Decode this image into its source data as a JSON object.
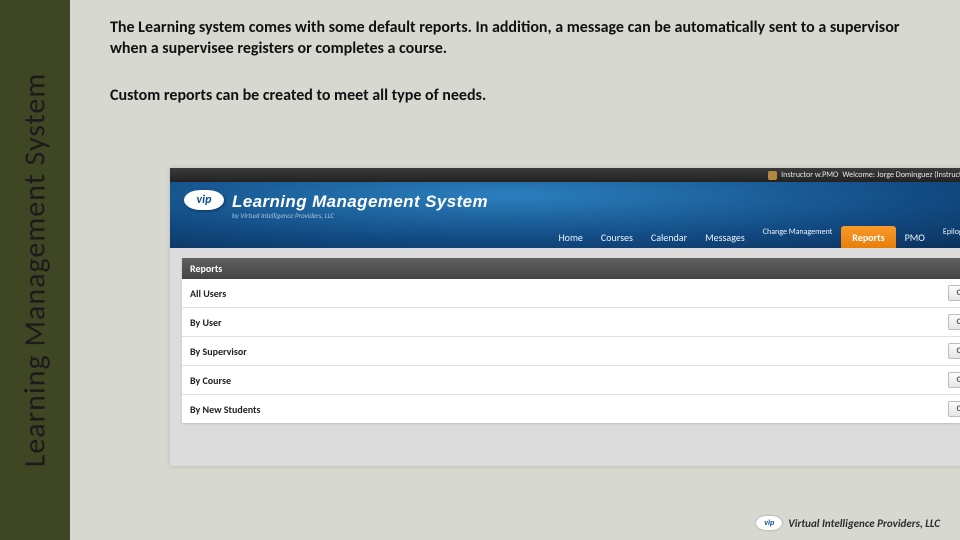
{
  "sidebar": {
    "title": "Learning Management System"
  },
  "body": {
    "para1": "The Learning system comes with some default reports. In addition, a message can be automatically sent to a supervisor when a supervisee registers or completes a course.",
    "para2": "Custom reports can be created to meet all type of needs."
  },
  "app": {
    "topbar": {
      "role": "Instructor w.PMO",
      "welcome": "Welcome: Jorge Dominguez (Instructor Portal)"
    },
    "brand": {
      "logo_text": "vip",
      "title": "Learning Management System",
      "subtitle": "by Virtual Intelligence Providers, LLC"
    },
    "nav": [
      {
        "label": "Home",
        "active": false
      },
      {
        "label": "Courses",
        "active": false
      },
      {
        "label": "Calendar",
        "active": false
      },
      {
        "label": "Messages",
        "active": false
      },
      {
        "label": "Change\nManagement",
        "active": false
      },
      {
        "label": "Reports",
        "active": true
      },
      {
        "label": "PMO",
        "active": false
      },
      {
        "label": "Epilogue\nPublisher",
        "active": false
      }
    ],
    "panel": {
      "header": "Reports",
      "rows": [
        {
          "label": "All Users",
          "button": "CREATE"
        },
        {
          "label": "By User",
          "button": "CREATE"
        },
        {
          "label": "By Supervisor",
          "button": "CREATE"
        },
        {
          "label": "By Course",
          "button": "CREATE"
        },
        {
          "label": "By New Students",
          "button": "CREATE"
        }
      ]
    }
  },
  "footer": {
    "logo_text": "vip",
    "company": "Virtual Intelligence Providers, LLC"
  }
}
